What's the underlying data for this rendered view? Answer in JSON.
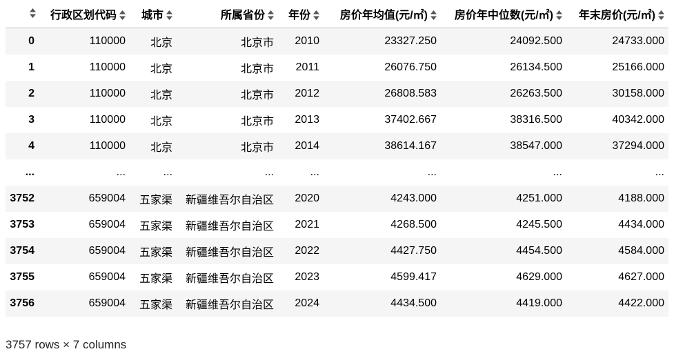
{
  "table": {
    "index_header": "",
    "columns": [
      "行政区划代码",
      "城市",
      "所属省份",
      "年份",
      "房价年均值(元/㎡)",
      "房价年中位数(元/㎡)",
      "年末房价(元/㎡)"
    ],
    "rows": [
      {
        "index": "0",
        "cells": [
          "110000",
          "北京",
          "北京市",
          "2010",
          "23327.250",
          "24092.500",
          "24733.000"
        ]
      },
      {
        "index": "1",
        "cells": [
          "110000",
          "北京",
          "北京市",
          "2011",
          "26076.750",
          "26134.500",
          "25166.000"
        ]
      },
      {
        "index": "2",
        "cells": [
          "110000",
          "北京",
          "北京市",
          "2012",
          "26808.583",
          "26263.500",
          "30158.000"
        ]
      },
      {
        "index": "3",
        "cells": [
          "110000",
          "北京",
          "北京市",
          "2013",
          "37402.667",
          "38316.500",
          "40342.000"
        ]
      },
      {
        "index": "4",
        "cells": [
          "110000",
          "北京",
          "北京市",
          "2014",
          "38614.167",
          "38547.000",
          "37294.000"
        ]
      },
      {
        "index": "...",
        "cells": [
          "...",
          "...",
          "...",
          "...",
          "...",
          "...",
          "..."
        ]
      },
      {
        "index": "3752",
        "cells": [
          "659004",
          "五家渠",
          "新疆维吾尔自治区",
          "2020",
          "4243.000",
          "4251.000",
          "4188.000"
        ]
      },
      {
        "index": "3753",
        "cells": [
          "659004",
          "五家渠",
          "新疆维吾尔自治区",
          "2021",
          "4268.500",
          "4245.500",
          "4434.000"
        ]
      },
      {
        "index": "3754",
        "cells": [
          "659004",
          "五家渠",
          "新疆维吾尔自治区",
          "2022",
          "4427.750",
          "4454.500",
          "4584.000"
        ]
      },
      {
        "index": "3755",
        "cells": [
          "659004",
          "五家渠",
          "新疆维吾尔自治区",
          "2023",
          "4599.417",
          "4629.000",
          "4627.000"
        ]
      },
      {
        "index": "3756",
        "cells": [
          "659004",
          "五家渠",
          "新疆维吾尔自治区",
          "2024",
          "4434.500",
          "4419.000",
          "4422.000"
        ]
      }
    ]
  },
  "footer": {
    "summary": "3757 rows × 7 columns"
  },
  "colors": {
    "row_odd": "#f5f5f5",
    "row_even": "#ffffff",
    "header_border": "#bdbdbd",
    "sort_icon": "#555555"
  },
  "icons": {
    "sort": "sort-icon"
  }
}
